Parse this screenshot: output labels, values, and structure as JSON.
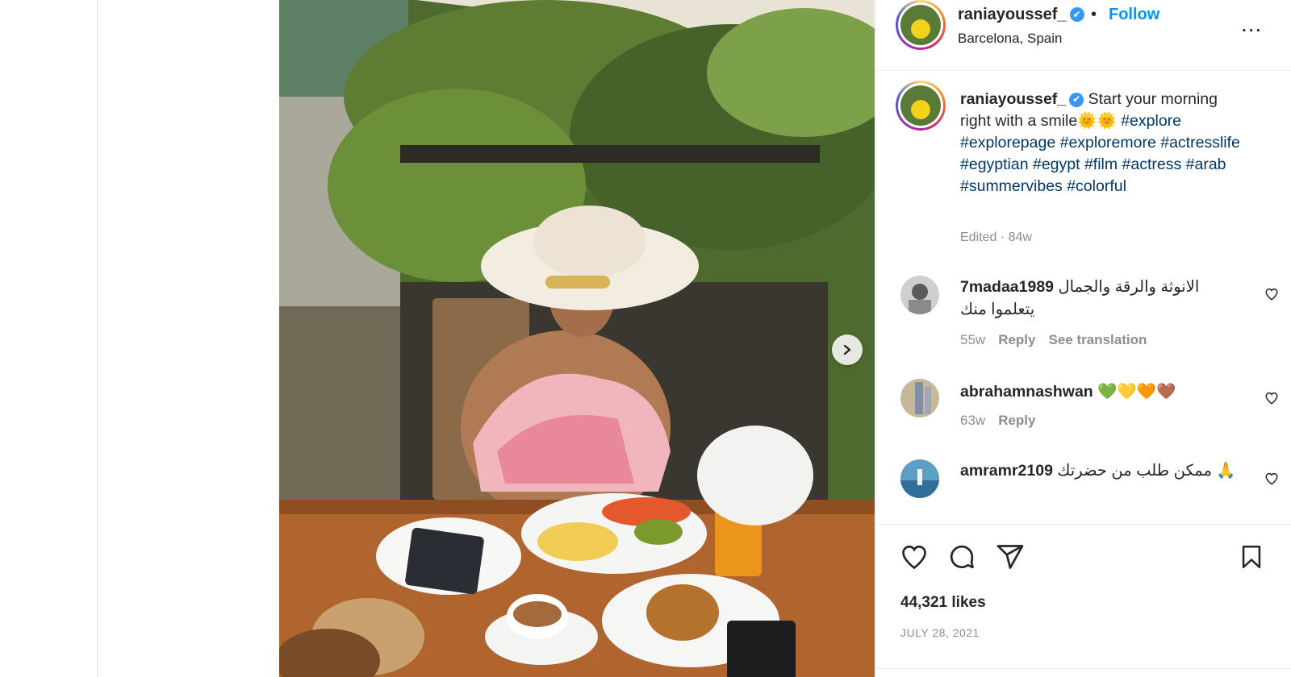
{
  "post": {
    "username": "raniayoussef_",
    "follow_label": "Follow",
    "bullet": "•",
    "location": "Barcelona, Spain",
    "more_label": "...",
    "verified_mark": "✔"
  },
  "caption": {
    "username": "raniayoussef_",
    "text": " Start your morning right with a smile🌞🌞 ",
    "hashtags": "#explore #explorepage #exploremore #actresslife #egyptian #egypt #film #actress #arab #summervibes #colorful",
    "meta": "Edited · 84w"
  },
  "comments": [
    {
      "username": "7madaa1989",
      "text": "الانوثة والرقة والجمال يتعلموا منك",
      "time": "55w",
      "reply": "Reply",
      "translate": "See translation"
    },
    {
      "username": "abrahamnashwan",
      "text": "💚💛🧡🤎",
      "time": "63w",
      "reply": "Reply"
    },
    {
      "username": "amramr2109",
      "text": "ممكن طلب من حضرتك 🙏",
      "time": "",
      "reply": ""
    }
  ],
  "stats": {
    "likes": "44,321 likes",
    "date": "JULY 28, 2021"
  },
  "colors": {
    "accent": "#0095f6",
    "verified": "#3897f0",
    "hashtag": "#00376b",
    "muted": "#8e8e8e"
  },
  "icons": [
    "verified-icon",
    "more-icon",
    "next-icon",
    "heart-icon",
    "comment-icon",
    "share-icon",
    "save-icon"
  ]
}
